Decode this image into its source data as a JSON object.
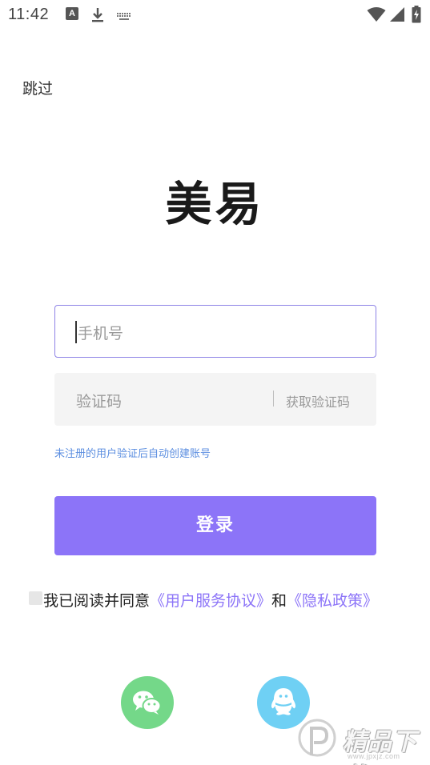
{
  "status_bar": {
    "time": "11:42",
    "notification_icons": [
      "text-a-icon",
      "download-icon",
      "keyboard-icon"
    ],
    "system_icons": [
      "wifi-icon",
      "signal-icon",
      "battery-charging-icon"
    ],
    "a_glyph": "A"
  },
  "skip_label": "跳过",
  "logo_text": "美易",
  "phone_input": {
    "placeholder": "手机号",
    "value": ""
  },
  "code_input": {
    "placeholder": "验证码",
    "value": "",
    "get_code_label": "获取验证码"
  },
  "hint_text": "未注册的用户验证后自动创建账号",
  "login_button_label": "登录",
  "agreement": {
    "checked": false,
    "prefix": "我已阅读并同意",
    "terms_link": "《用户服务协议》",
    "conjunction": "和",
    "privacy_link": "《隐私政策》"
  },
  "social_login": [
    {
      "name": "wechat",
      "icon": "wechat-icon",
      "color": "#74d889"
    },
    {
      "name": "qq",
      "icon": "qq-icon",
      "color": "#6fd0f4"
    }
  ],
  "watermark": {
    "text": "精品下载",
    "url": "www.jpxjz.com"
  },
  "colors": {
    "accent": "#8c74f8",
    "hint": "#5b8ee0",
    "input_border": "#8e83e6"
  }
}
